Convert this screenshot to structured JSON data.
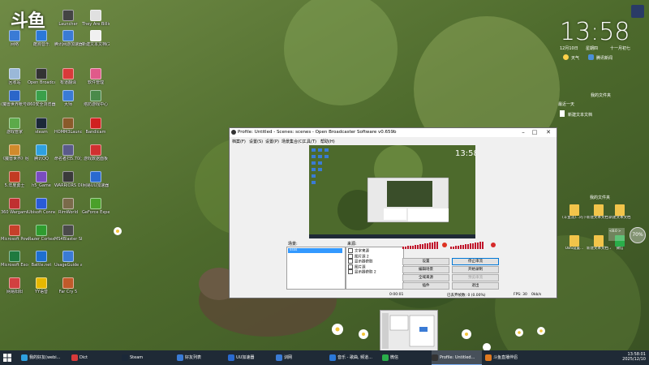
{
  "desktop": {
    "logo_text": "斗鱼",
    "icons": [
      {
        "label": "网络",
        "color": "#3a7bd5"
      },
      {
        "label": "回收站",
        "color": "#9ab8d8"
      },
      {
        "label": "(魔兽世界帐号助手",
        "color": "#2b66c9"
      },
      {
        "label": "游戏管家",
        "color": "#5caa4a"
      },
      {
        "label": "《魔兽世界》经典怀旧服",
        "color": "#d08a2c"
      },
      {
        "label": "5.年度勇士",
        "color": "#c23b22"
      },
      {
        "label": "360 Wargaming Game Ce...",
        "color": "#c03030"
      },
      {
        "label": "Microsoft PowerPoint 2...",
        "color": "#c6402a"
      },
      {
        "label": "Microsoft Excel 2016",
        "color": "#1f7a3f"
      },
      {
        "label": "网易阳阳",
        "color": "#d24040"
      },
      {
        "label": "酷狗音乐",
        "color": "#2b78d8"
      },
      {
        "label": "Open Broadcaster Soft...",
        "color": "#333333"
      },
      {
        "label": "360安全浏览器",
        "color": "#3aa04a"
      },
      {
        "label": "steam",
        "color": "#1b2838"
      },
      {
        "label": "腾讯QQ",
        "color": "#2ea0e0"
      },
      {
        "label": "h5_Game",
        "color": "#7a4cc0"
      },
      {
        "label": "Ubisoft Connect",
        "color": "#2a5bd7"
      },
      {
        "label": "Razer Cortex",
        "color": "#2f9c2f"
      },
      {
        "label": "Battle.net",
        "color": "#1e6fd0"
      },
      {
        "label": "YY语音",
        "color": "#e6b800"
      },
      {
        "label": "Launcher",
        "color": "#444444"
      },
      {
        "label": "腾讯网游加速器",
        "color": "#3a7bd5"
      },
      {
        "label": "有道翻译",
        "color": "#d83a3a"
      },
      {
        "label": "大师",
        "color": "#3a7bd5"
      },
      {
        "label": "HOMM3Launcher",
        "color": "#8a5a2a"
      },
      {
        "label": "命名者扫5.70(测试)",
        "color": "#5a5a8a"
      },
      {
        "label": "WARRIORS OROCHI 4...",
        "color": "#3a3a3a"
      },
      {
        "label": "RimWorld",
        "color": "#7a6a4a"
      },
      {
        "label": "MS4Blaster Shadow...",
        "color": "#4a4a4a"
      },
      {
        "label": "UsageGuide and Control",
        "color": "#3a7bd5"
      },
      {
        "label": "Far Cry 5",
        "color": "#c05a2a"
      },
      {
        "label": "They Are Billions",
        "color": "#e0e0e0"
      },
      {
        "label": "新建文本文档(2)",
        "color": "#f0f0f0"
      },
      {
        "label": "软件管理",
        "color": "#e05a8a"
      },
      {
        "label": "塔防游戏中心",
        "color": "#4a8a4a"
      },
      {
        "label": "Bandicam",
        "color": "#d02020"
      },
      {
        "label": "游戏数据面板",
        "color": "#d03030"
      },
      {
        "label": "网易UU加速器",
        "color": "#2a6ad0"
      },
      {
        "label": "GeForce Experience",
        "color": "#4aa02a"
      }
    ],
    "clock": {
      "time": "13:58",
      "date": "12月10日",
      "weekday": "星期四",
      "lunar": "十一月初七",
      "weather_label": "天气",
      "news_label": "腾讯新闻"
    },
    "recent": {
      "title": "最近一天",
      "item": "新建文本文档",
      "mydocs": "我的文件夹"
    },
    "docs_panel": {
      "title": "我的文件夹",
      "items": [
        {
          "label": "(斗鱼流)...的下载文档"
        },
        {
          "label": "新建文本文档 2"
        },
        {
          "label": "新建文本文档"
        },
        {
          "label": "OBS设置..."
        },
        {
          "label": "新建文本文档 3"
        },
        {
          "label": "微信"
        }
      ],
      "badge": "70%",
      "hint": "<8.0 >"
    }
  },
  "obs": {
    "title": "Profile: Untitled - Scenes: scenes - Open Broadcaster Software v0.659b",
    "menu": [
      "档案(F)",
      "设置(S)",
      "设置(P)",
      "场景集合(C)",
      "工具(T)",
      "帮助(H)"
    ],
    "preview_time": "13:58",
    "scenes_label": "场景:",
    "scene_item": "ssss",
    "sources_label": "来源:",
    "sources": [
      "文字来源",
      "图片源 2",
      "显示器获取",
      "图片源",
      "显示器获取 2"
    ],
    "buttons": {
      "settings": "设置",
      "start_stream": "停止串流",
      "edit_scene": "编辑场景",
      "start_record": "开始录制",
      "global_sources": "全域来源",
      "preview_stream": "预览串流",
      "plugins": "插件",
      "exit": "退出"
    },
    "status": {
      "time": "0:00:01",
      "dropped": "已丢弃帧数: 0 (0.00%)",
      "fps": "FPS: 30",
      "bitrate": "0kb/s"
    }
  },
  "taskbar": {
    "items": [
      {
        "label": "我的好友(webi...",
        "color": "#2ea0e0"
      },
      {
        "label": "Dict",
        "color": "#d83a3a"
      },
      {
        "label": "Steam",
        "color": "#1b2838"
      },
      {
        "label": "好友列表",
        "color": "#3a7bd5"
      },
      {
        "label": "UU加速器",
        "color": "#2a6ad0"
      },
      {
        "label": "训网",
        "color": "#3a7bd5"
      },
      {
        "label": "音乐 - 歌曲, 频道...",
        "color": "#2b78d8"
      },
      {
        "label": "微信",
        "color": "#2aae4a"
      },
      {
        "label": "Profile: Untitled...",
        "color": "#333333"
      },
      {
        "label": "斗鱼直播伴侣",
        "color": "#e07a20"
      }
    ],
    "tray_time": "13:58:01",
    "tray_date": "2025/12/10"
  }
}
